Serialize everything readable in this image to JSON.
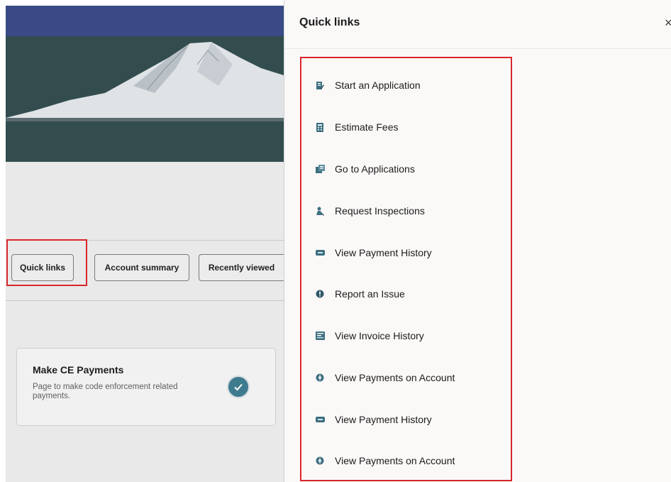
{
  "background": {
    "tabs": {
      "quick_links": "Quick links",
      "account_summary": "Account summary",
      "recently_viewed": "Recently viewed"
    },
    "card": {
      "title": "Make CE Payments",
      "description": "Page to make code enforcement related payments."
    }
  },
  "drawer": {
    "title": "Quick links",
    "close_glyph": "×",
    "links": [
      {
        "label": "Start an Application",
        "icon": "document-edit-icon"
      },
      {
        "label": "Estimate Fees",
        "icon": "calculator-icon"
      },
      {
        "label": "Go to Applications",
        "icon": "folder-icon"
      },
      {
        "label": "Request Inspections",
        "icon": "inspector-icon"
      },
      {
        "label": "View Payment History",
        "icon": "payment-icon"
      },
      {
        "label": "Report an Issue",
        "icon": "alert-icon"
      },
      {
        "label": "View Invoice History",
        "icon": "invoice-icon"
      },
      {
        "label": "View Payments on Account",
        "icon": "account-payment-icon"
      },
      {
        "label": "View Payment History",
        "icon": "payment-icon"
      },
      {
        "label": "View Payments on Account",
        "icon": "account-payment-icon"
      }
    ]
  },
  "colors": {
    "accent": "#3f7b8f",
    "highlight": "#d9262b",
    "icon": "#3d6f80"
  }
}
